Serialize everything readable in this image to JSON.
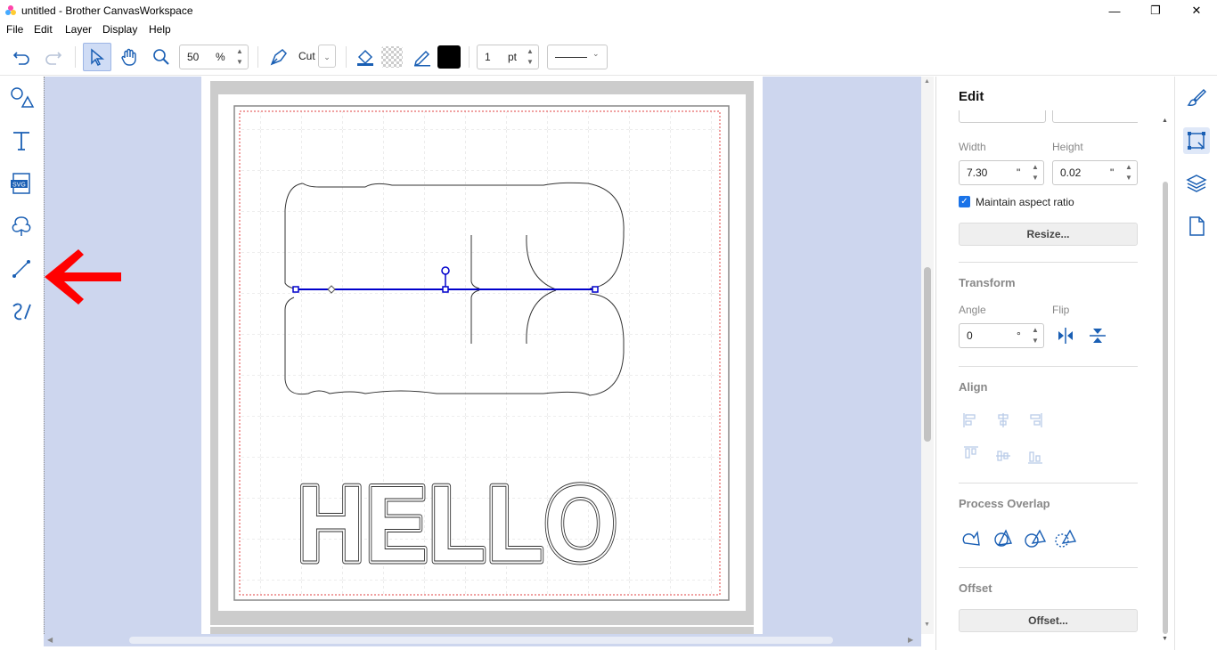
{
  "window": {
    "title": "untitled - Brother CanvasWorkspace",
    "minimize": "—",
    "restore": "❐",
    "close": "✕"
  },
  "menu": [
    "File",
    "Edit",
    "Layer",
    "Display",
    "Help"
  ],
  "toolbar": {
    "zoom_value": "50",
    "zoom_unit": "%",
    "tool_mode": "Cut",
    "line_width_value": "1",
    "line_width_unit": "pt"
  },
  "colors": {
    "accent": "#1a73e8",
    "selection_line": "#0000cc",
    "arrow": "#ff0000",
    "canvas_bg": "#cdd6ee",
    "cut_border": "#e04040"
  },
  "canvas": {
    "text": "HELLO"
  },
  "edit_panel": {
    "title": "Edit",
    "width_label": "Width",
    "height_label": "Height",
    "width_value": "7.30",
    "width_unit": "\"",
    "height_value": "0.02",
    "height_unit": "\"",
    "aspect_label": "Maintain aspect ratio",
    "aspect_checked": true,
    "resize_label": "Resize...",
    "transform_title": "Transform",
    "angle_label": "Angle",
    "flip_label": "Flip",
    "angle_value": "0",
    "angle_unit": "°",
    "align_title": "Align",
    "process_title": "Process Overlap",
    "offset_title": "Offset",
    "offset_button": "Offset..."
  }
}
